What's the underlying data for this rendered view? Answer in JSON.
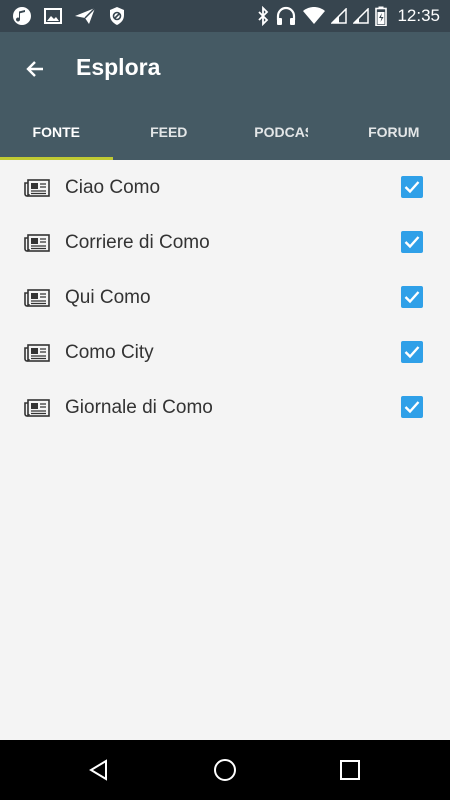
{
  "status_bar": {
    "time": "12:35",
    "left_icons": [
      "music-note-icon",
      "image-icon",
      "send-icon",
      "vpn-shield-icon"
    ],
    "right_icons": [
      "bluetooth-icon",
      "headphones-icon",
      "wifi-icon",
      "signal-icon",
      "signal-icon",
      "battery-icon"
    ]
  },
  "app_bar": {
    "title": "Esplora",
    "back_icon": "arrow-back-icon"
  },
  "tabs": [
    {
      "label": "FONTE",
      "selected": true
    },
    {
      "label": "FEED",
      "selected": false
    },
    {
      "label": "PODCAST",
      "selected": false
    },
    {
      "label": "FORUM",
      "selected": false
    }
  ],
  "sources": [
    {
      "name": "Ciao Como",
      "checked": true
    },
    {
      "name": "Corriere di Como",
      "checked": true
    },
    {
      "name": "Qui Como",
      "checked": true
    },
    {
      "name": "Como City",
      "checked": true
    },
    {
      "name": "Giornale di Como",
      "checked": true
    }
  ],
  "colors": {
    "status_bar": "#37454f",
    "app_bar": "#455a64",
    "tab_indicator": "#c0ca33",
    "checkbox": "#2fa0e8",
    "background": "#f4f4f4"
  },
  "nav_bar": {
    "buttons": [
      "back-triangle-icon",
      "home-circle-icon",
      "recents-square-icon"
    ]
  }
}
